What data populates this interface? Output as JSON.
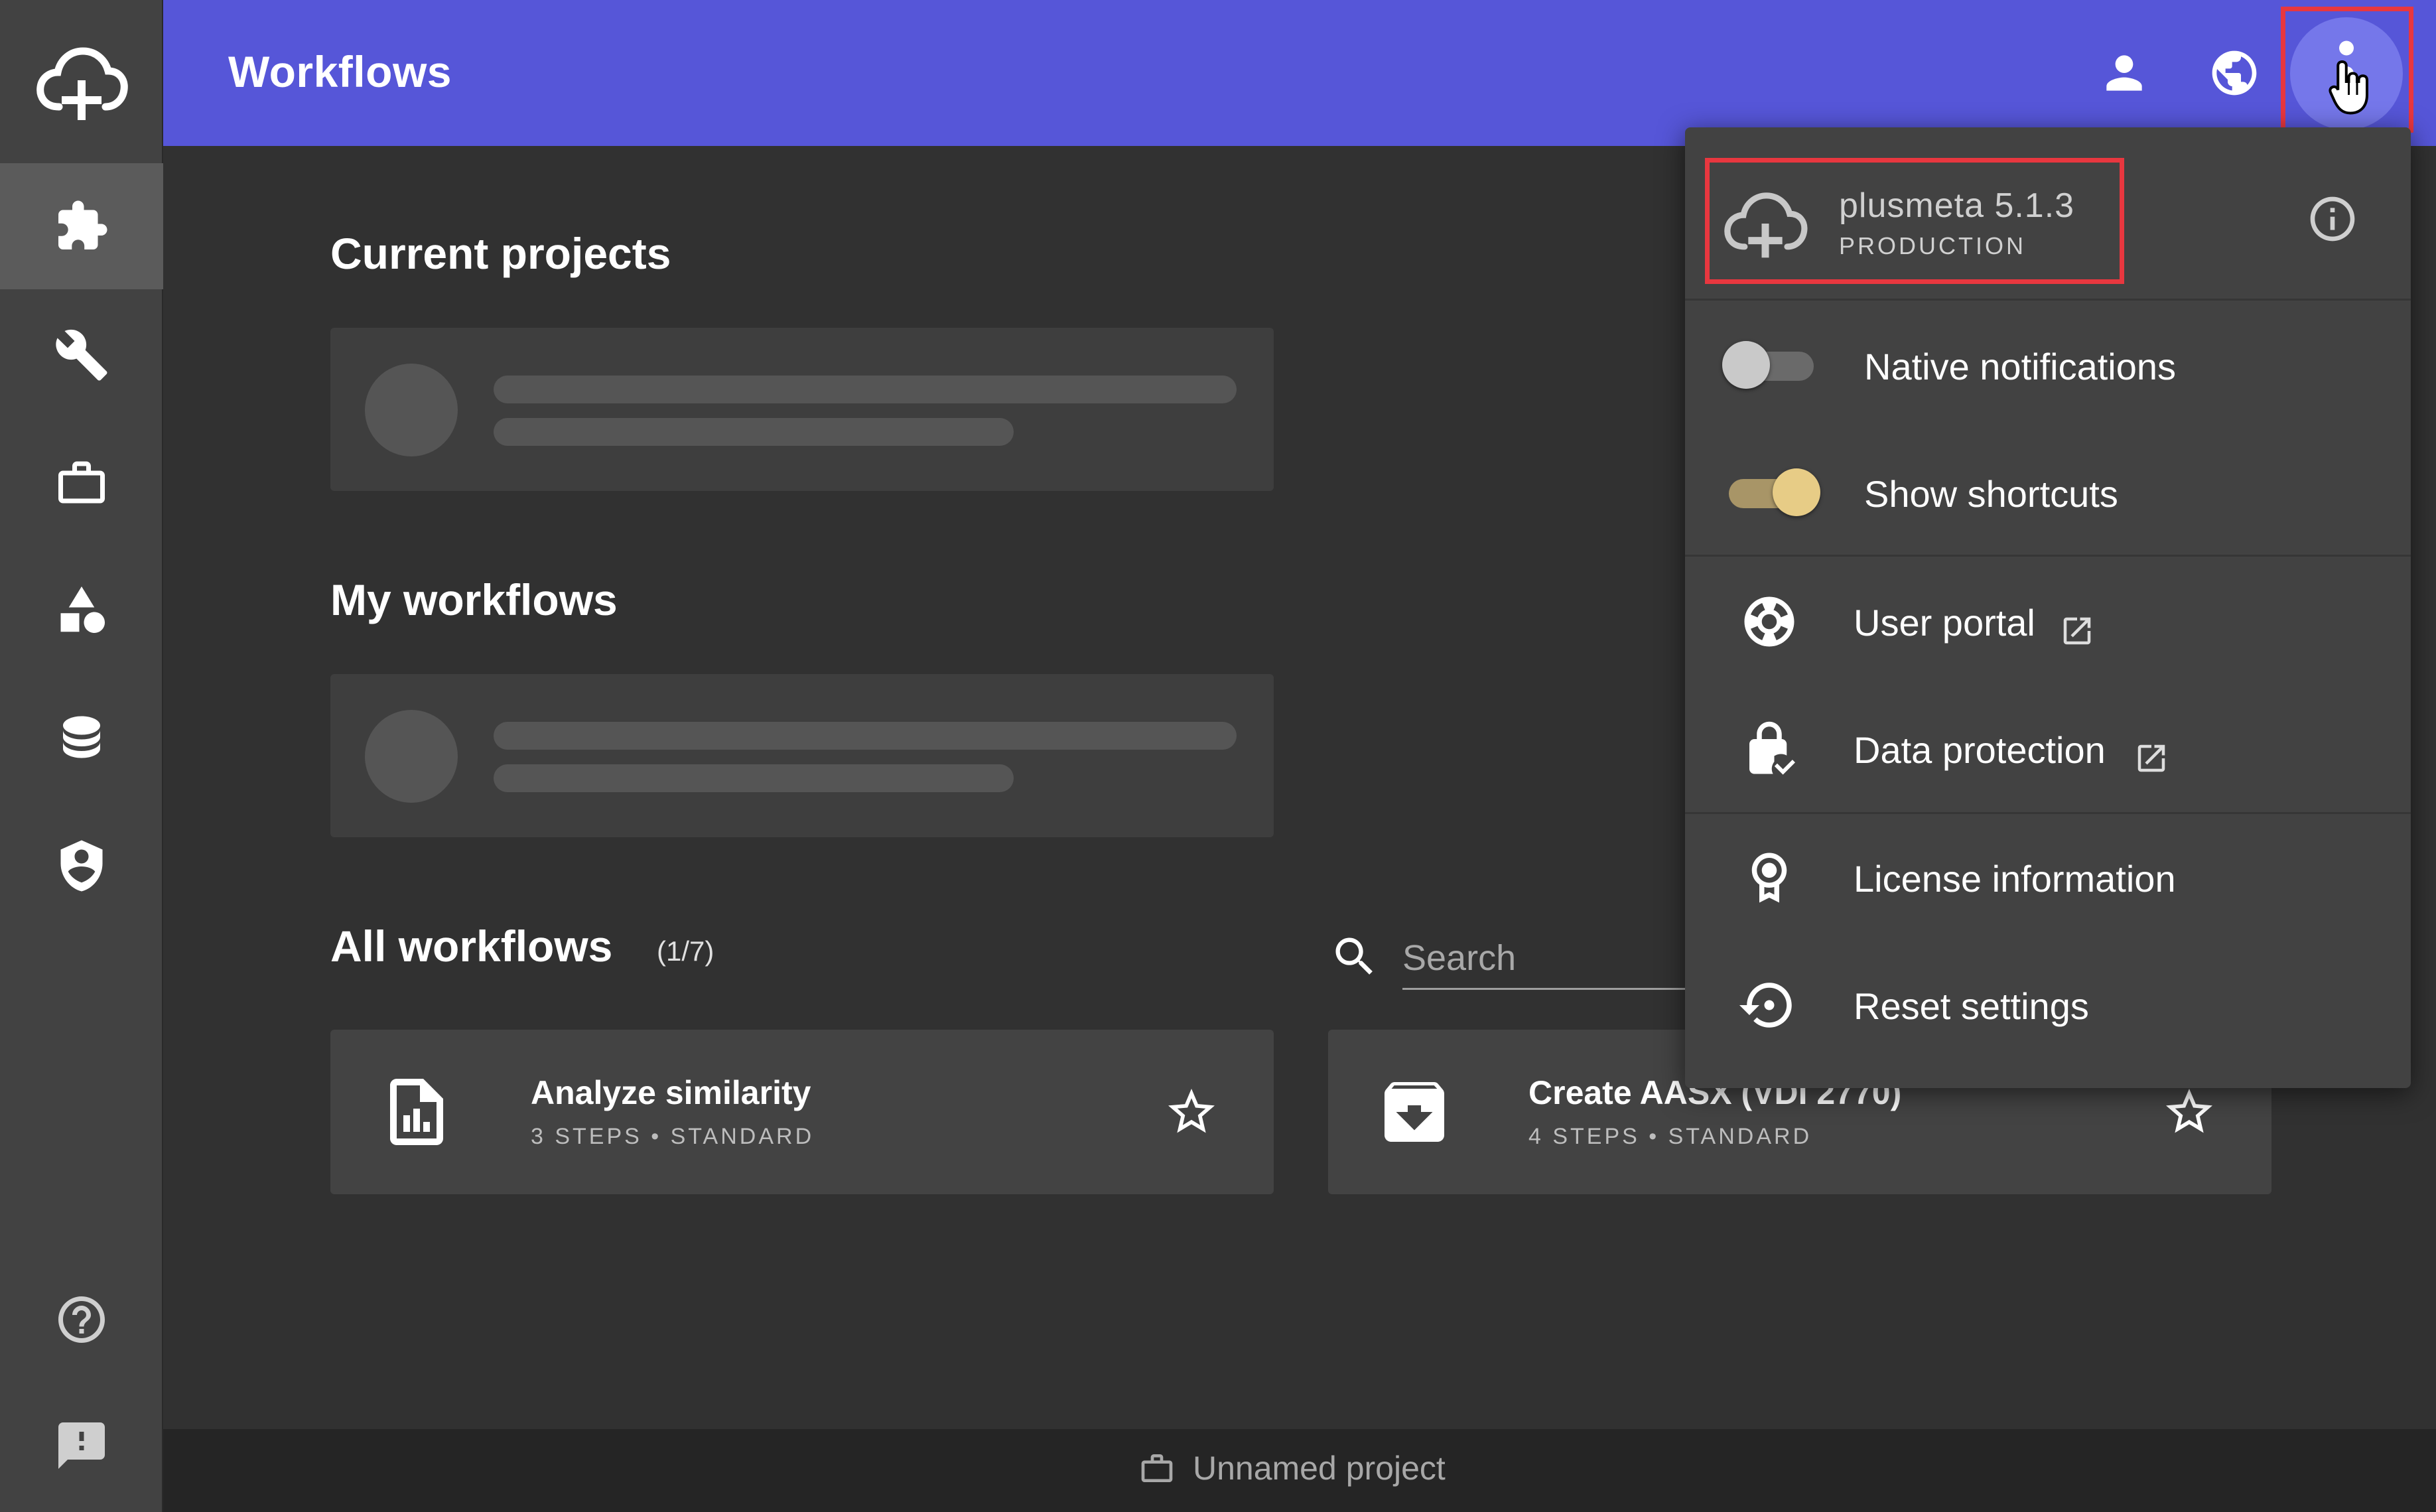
{
  "app": {
    "title": "Workflows",
    "accent_color": "#5656d8",
    "background_color": "#313131"
  },
  "sidebar": {
    "items": [
      {
        "name": "workflows",
        "icon": "puzzle-icon",
        "active": true
      },
      {
        "name": "tools",
        "icon": "wrench-icon",
        "active": false
      },
      {
        "name": "projects",
        "icon": "briefcase-icon",
        "active": false
      },
      {
        "name": "shapes",
        "icon": "shapes-icon",
        "active": false
      },
      {
        "name": "database",
        "icon": "database-icon",
        "active": false
      },
      {
        "name": "security",
        "icon": "shield-icon",
        "active": false
      }
    ],
    "bottom_items": [
      {
        "name": "help",
        "icon": "help-icon"
      },
      {
        "name": "feedback",
        "icon": "feedback-icon"
      }
    ]
  },
  "header": {
    "icons": [
      "account-icon",
      "globe-icon",
      "more-vert-icon"
    ]
  },
  "main": {
    "current_projects_title": "Current projects",
    "my_workflows_title": "My workflows",
    "all_workflows_title": "All workflows",
    "all_workflows_count": "(1/7)",
    "search": {
      "placeholder": "Search",
      "value": ""
    },
    "workflow_cards": [
      {
        "name": "Analyze similarity",
        "meta": "3 STEPS • STANDARD",
        "icon": "chart-file-icon"
      },
      {
        "name": "Create AASX (VDI 2770)",
        "meta": "4 STEPS • STANDARD",
        "icon": "archive-download-icon"
      }
    ]
  },
  "menu": {
    "version_name": "plusmeta 5.1.3",
    "environment": "PRODUCTION",
    "native_notifications": {
      "label": "Native notifications",
      "enabled": false
    },
    "show_shortcuts": {
      "label": "Show shortcuts",
      "enabled": true
    },
    "user_portal": "User portal",
    "data_protection": "Data protection",
    "license_information": "License information",
    "reset_settings": "Reset settings"
  },
  "footer": {
    "project_name": "Unnamed project"
  },
  "colors": {
    "highlight": "#e8373f",
    "toggle_on": "#e7cc86"
  }
}
